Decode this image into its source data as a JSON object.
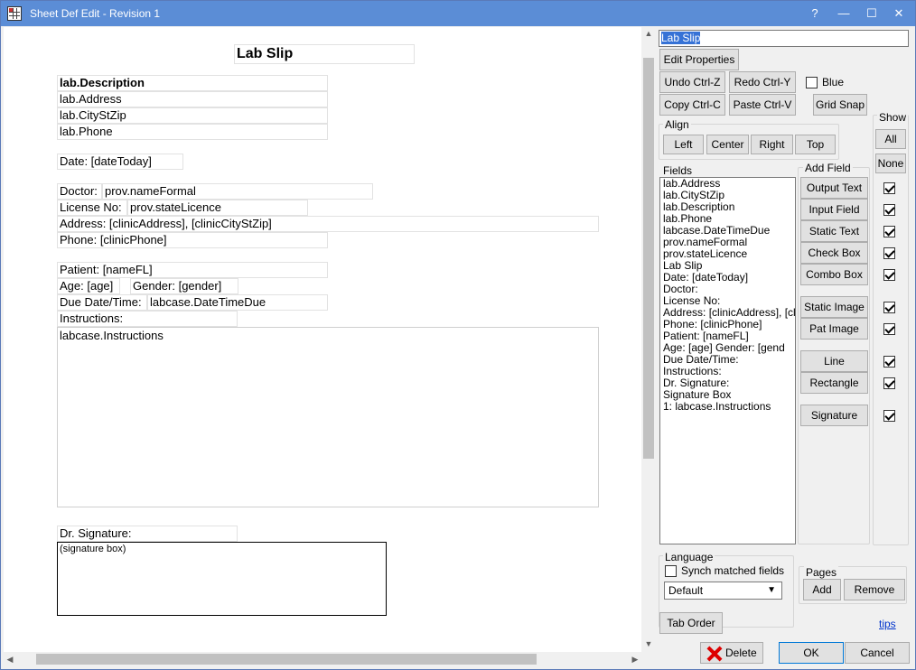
{
  "window": {
    "title": "Sheet Def Edit - Revision 1",
    "controls": {
      "help": "?",
      "minimize": "—",
      "maximize": "☐",
      "close": "✕"
    }
  },
  "canvas": {
    "title": "Lab Slip",
    "lab_description": "lab.Description",
    "lab_address": "lab.Address",
    "lab_citystzip": "lab.CityStZip",
    "lab_phone": "lab.Phone",
    "date": "Date:  [dateToday]",
    "doctor_label": "Doctor:",
    "doctor_value": "prov.nameFormal",
    "license_label": "License No:",
    "license_value": "prov.stateLicence",
    "address": "Address:  [clinicAddress],  [clinicCityStZip]",
    "phone": "Phone:  [clinicPhone]",
    "patient": "Patient:  [nameFL]",
    "age": "Age:  [age]",
    "gender": "Gender:  [gender]",
    "due_label": "Due Date/Time:",
    "due_value": "labcase.DateTimeDue",
    "instructions_label": "Instructions:",
    "instructions_box": "labcase.Instructions",
    "dr_signature": "Dr. Signature:",
    "signature_box": "(signature box)"
  },
  "panel": {
    "name_field": "Lab Slip",
    "edit_properties": "Edit Properties",
    "undo": "Undo Ctrl-Z",
    "redo": "Redo Ctrl-Y",
    "blue": "Blue",
    "blue_checked": false,
    "copy": "Copy Ctrl-C",
    "paste": "Paste Ctrl-V",
    "grid_snap": "Grid Snap",
    "align": {
      "label": "Align",
      "left": "Left",
      "center": "Center",
      "right": "Right",
      "top": "Top"
    },
    "show": {
      "label": "Show",
      "all": "All",
      "none": "None"
    },
    "fields_label": "Fields",
    "fields": [
      "lab.Address",
      "lab.CityStZip",
      "lab.Description",
      "lab.Phone",
      "labcase.DateTimeDue",
      "prov.nameFormal",
      "prov.stateLicence",
      "Lab Slip",
      "Date:  [dateToday]",
      "Doctor:",
      "License No:",
      "Address:  [clinicAddress],  [cl",
      "Phone:  [clinicPhone]",
      "Patient:  [nameFL]",
      "Age: [age]       Gender: [gend",
      "Due Date/Time:",
      "Instructions:",
      "Dr. Signature:",
      "Signature Box",
      "1: labcase.Instructions"
    ],
    "add_field": {
      "label": "Add Field",
      "output_text": "Output Text",
      "input_field": "Input Field",
      "static_text": "Static Text",
      "check_box": "Check Box",
      "combo_box": "Combo Box",
      "static_image": "Static Image",
      "pat_image": "Pat Image",
      "line": "Line",
      "rectangle": "Rectangle",
      "signature": "Signature"
    },
    "language": {
      "label": "Language",
      "synch": "Synch matched fields",
      "synch_checked": false,
      "selected": "Default"
    },
    "pages": {
      "label": "Pages",
      "add": "Add",
      "remove": "Remove"
    },
    "tab_order": "Tab Order",
    "tips": "tips",
    "delete": "Delete",
    "ok": "OK",
    "cancel": "Cancel"
  }
}
